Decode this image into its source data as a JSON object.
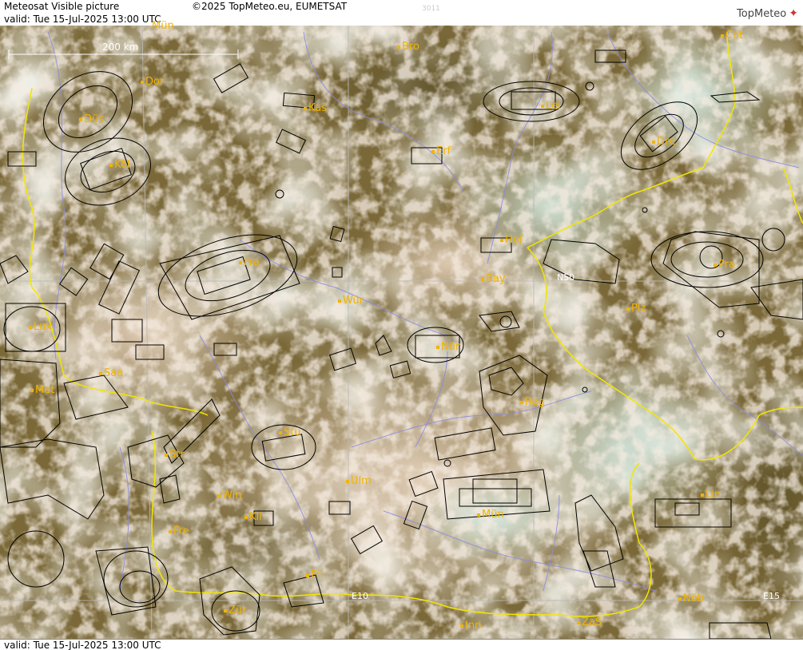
{
  "header": {
    "title": "Meteosat Visible picture",
    "copyright": "©2025 TopMeteo.eu, EUMETSAT",
    "code": "3011",
    "valid_top": "valid:  Tue  15-Jul-2025  13:00 UTC",
    "valid_bottom": "valid:  Tue  15-Jul-2025  13:00 UTC",
    "logo": "TopMeteo"
  },
  "scale_bar": {
    "label": "200 km"
  },
  "grid_labels": {
    "lat": "N50",
    "lon10": "E10",
    "lon15": "E15"
  },
  "cities": [
    {
      "id": "mun-top",
      "name": "Mün"
    },
    {
      "id": "bro",
      "name": "Bro"
    },
    {
      "id": "cot",
      "name": "Cot"
    },
    {
      "id": "dor",
      "name": "Dor"
    },
    {
      "id": "kas",
      "name": "Kas"
    },
    {
      "id": "lei",
      "name": "Lei"
    },
    {
      "id": "dus",
      "name": "Düs"
    },
    {
      "id": "erf",
      "name": "Erf"
    },
    {
      "id": "dre",
      "name": "Dre"
    },
    {
      "id": "kol",
      "name": "Köl"
    },
    {
      "id": "hof",
      "name": "Hof"
    },
    {
      "id": "fra",
      "name": "Fra"
    },
    {
      "id": "bay",
      "name": "Bay"
    },
    {
      "id": "pra",
      "name": "Pra"
    },
    {
      "id": "wur",
      "name": "Wür"
    },
    {
      "id": "plz",
      "name": "Plz"
    },
    {
      "id": "lux",
      "name": "Lux"
    },
    {
      "id": "nur",
      "name": "Nür"
    },
    {
      "id": "saa",
      "name": "Saa"
    },
    {
      "id": "met",
      "name": "Met"
    },
    {
      "id": "reg",
      "name": "Reg"
    },
    {
      "id": "stu",
      "name": "Stu"
    },
    {
      "id": "str",
      "name": "Str"
    },
    {
      "id": "ulm",
      "name": "Ulm"
    },
    {
      "id": "win",
      "name": "Win"
    },
    {
      "id": "kli",
      "name": "Kli"
    },
    {
      "id": "mun",
      "name": "Mün"
    },
    {
      "id": "lin",
      "name": "Lin"
    },
    {
      "id": "fre",
      "name": "Fre"
    },
    {
      "id": "fri",
      "name": "Fri"
    },
    {
      "id": "nob",
      "name": "Nöb"
    },
    {
      "id": "zur",
      "name": "Zür"
    },
    {
      "id": "inn",
      "name": "Inn"
    },
    {
      "id": "zas",
      "name": "ZaS"
    }
  ],
  "colors": {
    "city_label": "#f0b400",
    "border": "#f2e600",
    "river": "#8a8ae8",
    "grid": "#b9b9b9",
    "airspace": "#000000",
    "land_dark": "#6b5a2e",
    "cloud": "#e8d6c4",
    "cloud_cyan": "#cfe6dc"
  }
}
